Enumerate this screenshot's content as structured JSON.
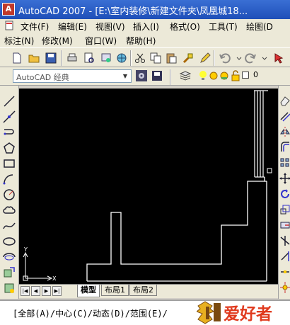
{
  "titlebar": {
    "title": "AutoCAD 2007 - [E:\\室内装修\\新建文件夹\\凤凰城18..."
  },
  "menu_row1": [
    {
      "label": "文件(F)"
    },
    {
      "label": "编辑(E)"
    },
    {
      "label": "视图(V)"
    },
    {
      "label": "插入(I)"
    },
    {
      "label": "格式(O)"
    },
    {
      "label": "工具(T)"
    },
    {
      "label": "绘图(D"
    }
  ],
  "menu_row2": [
    {
      "label": "标注(N)"
    },
    {
      "label": "修改(M)"
    },
    {
      "label": "窗口(W)"
    },
    {
      "label": "帮助(H)"
    }
  ],
  "workspace": {
    "value": "AutoCAD 经典"
  },
  "layer": {
    "value": "0"
  },
  "drawing_tabs": [
    {
      "label": "模型"
    },
    {
      "label": "布局1"
    },
    {
      "label": "布局2"
    }
  ],
  "ucs": {
    "y_label": "Y",
    "x_label": "X"
  },
  "command_line": {
    "text": "[全部(A)/中心(C)/动态(D)/范围(E)/"
  },
  "watermark": {
    "text": "爱好者"
  },
  "colors": {
    "titlebar": "#2a5fc8",
    "canvas": "#000000",
    "lines": "#ffffff",
    "watermark": "#e03a1e"
  }
}
